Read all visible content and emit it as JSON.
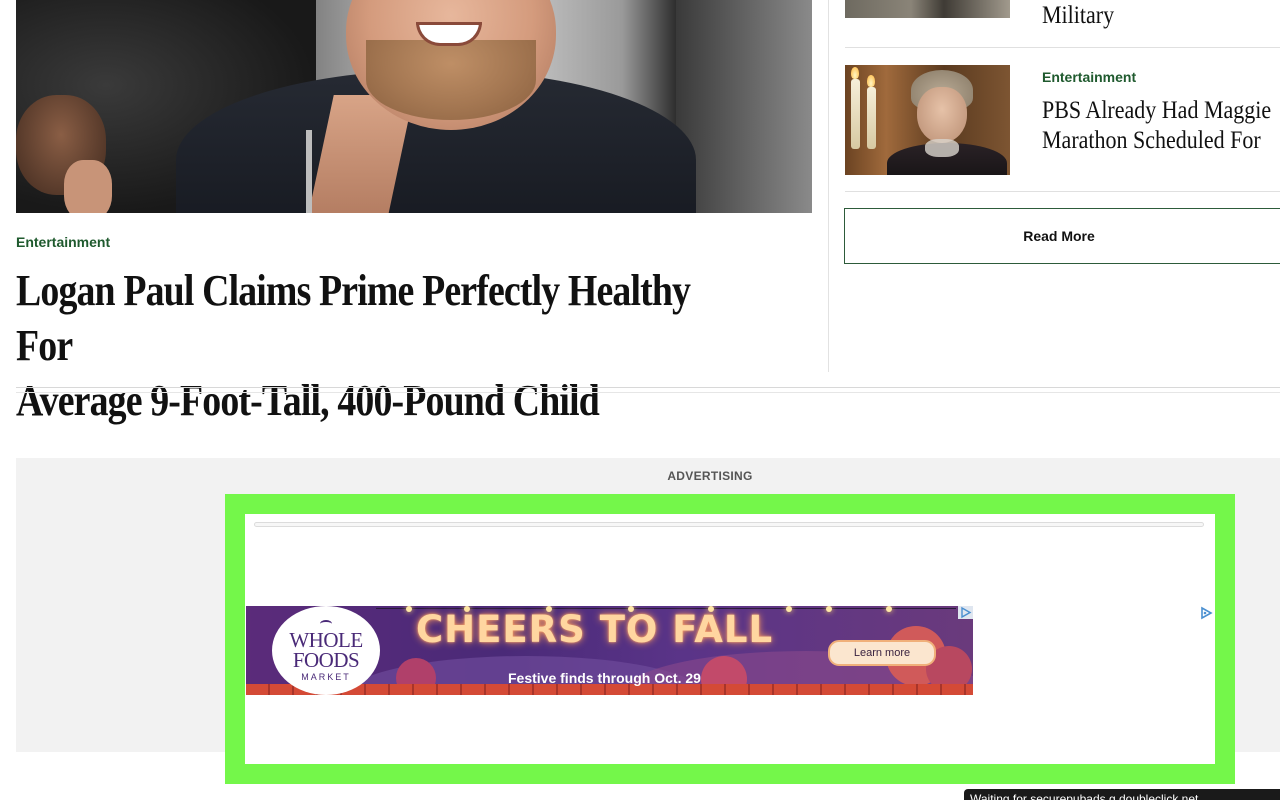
{
  "hero": {
    "category": "Entertainment",
    "headline_line1": "Logan Paul Claims Prime Perfectly Healthy For",
    "headline_line2": "Average 9-Foot-Tall, 400-Pound Child"
  },
  "sidebar": {
    "items": [
      {
        "title": "Military"
      },
      {
        "category": "Entertainment",
        "title_line1": "PBS Already Had Maggie",
        "title_line2": "Marathon Scheduled For"
      }
    ],
    "read_more_label": "Read More"
  },
  "ad": {
    "label": "ADVERTISING",
    "brand_line1": "WHOLE",
    "brand_line2": "FOODS",
    "brand_line3": "MARKET",
    "headline": "CHEERS TO FALL",
    "subtext": "Festive finds through Oct. 29",
    "cta": "Learn more",
    "adchoices_icon": "adchoices-icon"
  },
  "status": {
    "text": "Waiting for securepubads.g.doubleclick.net..."
  },
  "colors": {
    "category": "#1f5a2e",
    "ad_frame": "#74f74a",
    "ad_background": "#f2f2f2",
    "banner": "#4a2a78"
  }
}
